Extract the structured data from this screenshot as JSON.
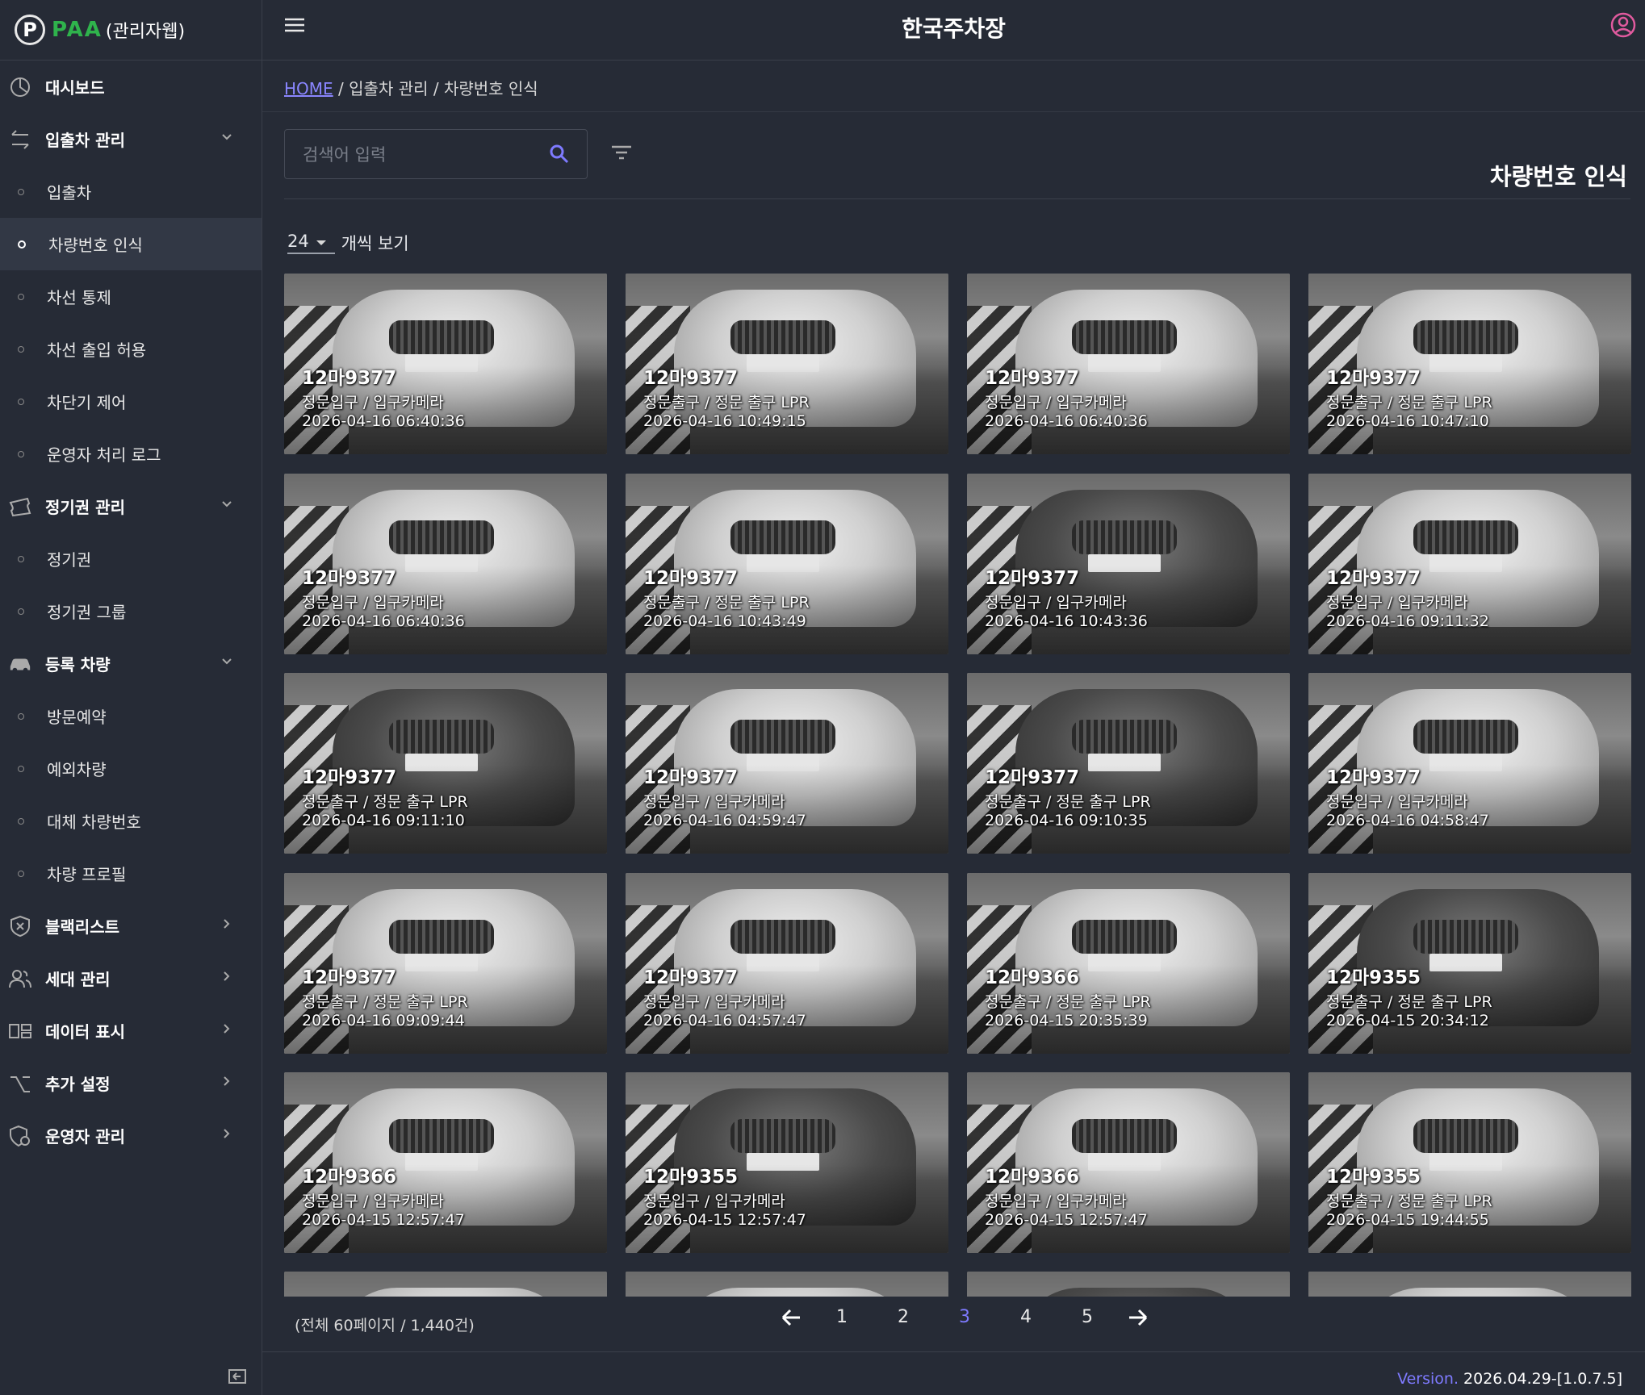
{
  "brand": {
    "logo_letter": "P",
    "name": "PAA",
    "subtitle": "(관리자웹)",
    "color": "#2fb34c"
  },
  "header": {
    "title": "한국주차장"
  },
  "breadcrumb": {
    "home": "HOME",
    "sep1": " / ",
    "section": "입출차 관리",
    "sep2": " / ",
    "page": "차량번호 인식"
  },
  "search": {
    "placeholder": "검색어 입력"
  },
  "page_title": "차량번호 인식",
  "per_page": {
    "value": "24",
    "suffix": "개씩 보기"
  },
  "sidebar": {
    "dashboard": "대시보드",
    "inout": {
      "label": "입출차 관리",
      "items": [
        "입출차",
        "차량번호 인식",
        "차선 통제",
        "차선 출입 허용",
        "차단기 제어",
        "운영자 처리 로그"
      ]
    },
    "season": {
      "label": "정기권 관리",
      "items": [
        "정기권",
        "정기권 그룹"
      ]
    },
    "registered": {
      "label": "등록 차량",
      "items": [
        "방문예약",
        "예외차량",
        "대체 차량번호",
        "차량 프로필"
      ]
    },
    "blacklist": "블랙리스트",
    "household": "세대 관리",
    "data_display": "데이터 표시",
    "extra": "추가 설정",
    "operator": "운영자 관리"
  },
  "records": [
    {
      "plate": "12마9377",
      "location": "정문입구 / 입구카메라",
      "time": "2026-04-16 06:40:36"
    },
    {
      "plate": "12마9377",
      "location": "정문출구 / 정문 출구 LPR",
      "time": "2026-04-16 10:49:15"
    },
    {
      "plate": "12마9377",
      "location": "정문입구 / 입구카메라",
      "time": "2026-04-16 06:40:36"
    },
    {
      "plate": "12마9377",
      "location": "정문출구 / 정문 출구 LPR",
      "time": "2026-04-16 10:47:10"
    },
    {
      "plate": "12마9377",
      "location": "정문입구 / 입구카메라",
      "time": "2026-04-16 06:40:36"
    },
    {
      "plate": "12마9377",
      "location": "정문출구 / 정문 출구 LPR",
      "time": "2026-04-16 10:43:49"
    },
    {
      "plate": "12마9377",
      "location": "정문입구 / 입구카메라",
      "time": "2026-04-16 10:43:36"
    },
    {
      "plate": "12마9377",
      "location": "정문입구 / 입구카메라",
      "time": "2026-04-16 09:11:32"
    },
    {
      "plate": "12마9377",
      "location": "정문출구 / 정문 출구 LPR",
      "time": "2026-04-16 09:11:10"
    },
    {
      "plate": "12마9377",
      "location": "정문입구 / 입구카메라",
      "time": "2026-04-16 04:59:47"
    },
    {
      "plate": "12마9377",
      "location": "정문출구 / 정문 출구 LPR",
      "time": "2026-04-16 09:10:35"
    },
    {
      "plate": "12마9377",
      "location": "정문입구 / 입구카메라",
      "time": "2026-04-16 04:58:47"
    },
    {
      "plate": "12마9377",
      "location": "정문출구 / 정문 출구 LPR",
      "time": "2026-04-16 09:09:44"
    },
    {
      "plate": "12마9377",
      "location": "정문입구 / 입구카메라",
      "time": "2026-04-16 04:57:47"
    },
    {
      "plate": "12마9366",
      "location": "정문출구 / 정문 출구 LPR",
      "time": "2026-04-15 20:35:39"
    },
    {
      "plate": "12마9355",
      "location": "정문출구 / 정문 출구 LPR",
      "time": "2026-04-15 20:34:12"
    },
    {
      "plate": "12마9366",
      "location": "정문입구 / 입구카메라",
      "time": "2026-04-15 12:57:47"
    },
    {
      "plate": "12마9355",
      "location": "정문입구 / 입구카메라",
      "time": "2026-04-15 12:57:47"
    },
    {
      "plate": "12마9366",
      "location": "정문입구 / 입구카메라",
      "time": "2026-04-15 12:57:47"
    },
    {
      "plate": "12마9355",
      "location": "정문출구 / 정문 출구 LPR",
      "time": "2026-04-15 19:44:55"
    }
  ],
  "pagination": {
    "total": "(전체 60페이지 / 1,440건)",
    "pages": [
      "1",
      "2",
      "3",
      "4",
      "5"
    ],
    "current": "3"
  },
  "footer": {
    "version_label": "Version.",
    "version": "2026.04.29-[1.0.7.5]"
  },
  "colors": {
    "background": "#262b36",
    "accent": "#7e7aff",
    "brand_green": "#2fb34c"
  }
}
